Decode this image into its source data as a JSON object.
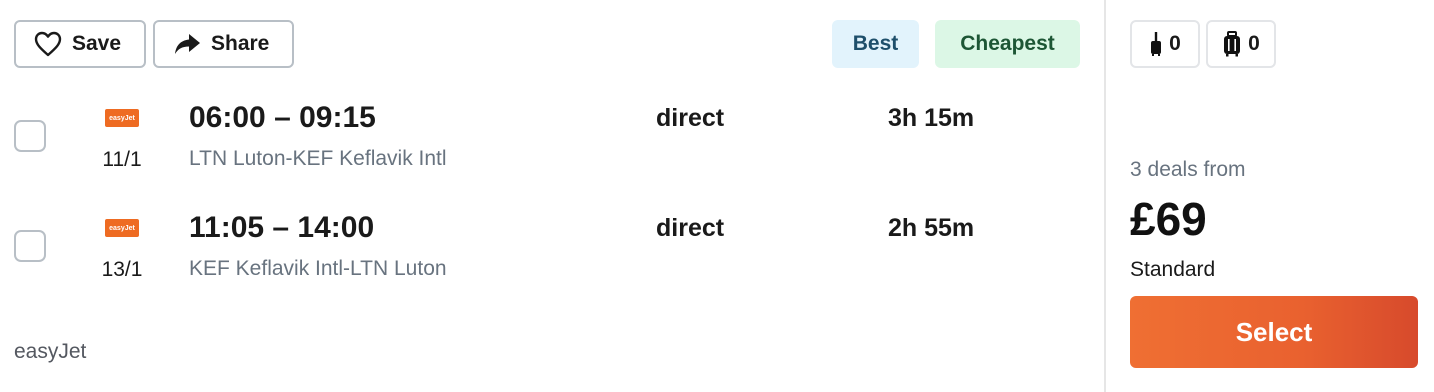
{
  "actions": {
    "save_label": "Save",
    "share_label": "Share"
  },
  "tags": {
    "best": "Best",
    "cheapest": "Cheapest"
  },
  "legs": [
    {
      "airline_logo": "easyJet",
      "date": "11/1",
      "times": "06:00 – 09:15",
      "route": "LTN Luton-KEF Keflavik Intl",
      "stops": "direct",
      "duration": "3h 15m"
    },
    {
      "airline_logo": "easyJet",
      "date": "13/1",
      "times": "11:05 – 14:00",
      "route": "KEF Keflavik Intl-LTN Luton",
      "stops": "direct",
      "duration": "2h 55m"
    }
  ],
  "carrier": "easyJet",
  "baggage": {
    "cabin_count": "0",
    "checked_count": "0"
  },
  "pricing": {
    "deals_text": "3 deals from",
    "price": "£69",
    "fare_type": "Standard",
    "select_label": "Select"
  },
  "colors": {
    "easyjet_orange": "#ee6b22",
    "best_bg": "#e2f3fc",
    "cheapest_bg": "#dcf7e6",
    "select_button": "#e9612f"
  },
  "icons": {
    "save": "heart-outline-icon",
    "share": "share-arrow-icon",
    "cabin_bag": "cabin-bag-icon",
    "checked_bag": "checked-bag-icon"
  }
}
